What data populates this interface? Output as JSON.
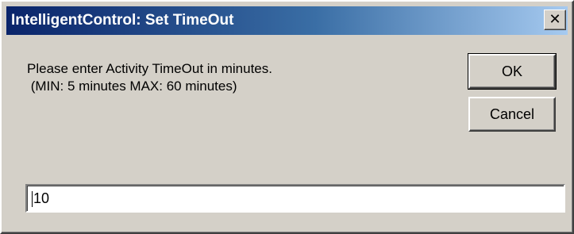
{
  "window": {
    "title": "IntelligentControl: Set TimeOut",
    "close_glyph": "✕",
    "close_icon": "close-icon"
  },
  "message": {
    "line1": "Please enter Activity TimeOut in minutes.",
    "line2": " (MIN: 5 minutes MAX: 60 minutes)"
  },
  "buttons": {
    "ok_label": "OK",
    "cancel_label": "Cancel"
  },
  "input": {
    "value": "10"
  },
  "colors": {
    "title_start": "#0a246a",
    "title_end": "#a6caf0",
    "face": "#d4d0c8"
  }
}
